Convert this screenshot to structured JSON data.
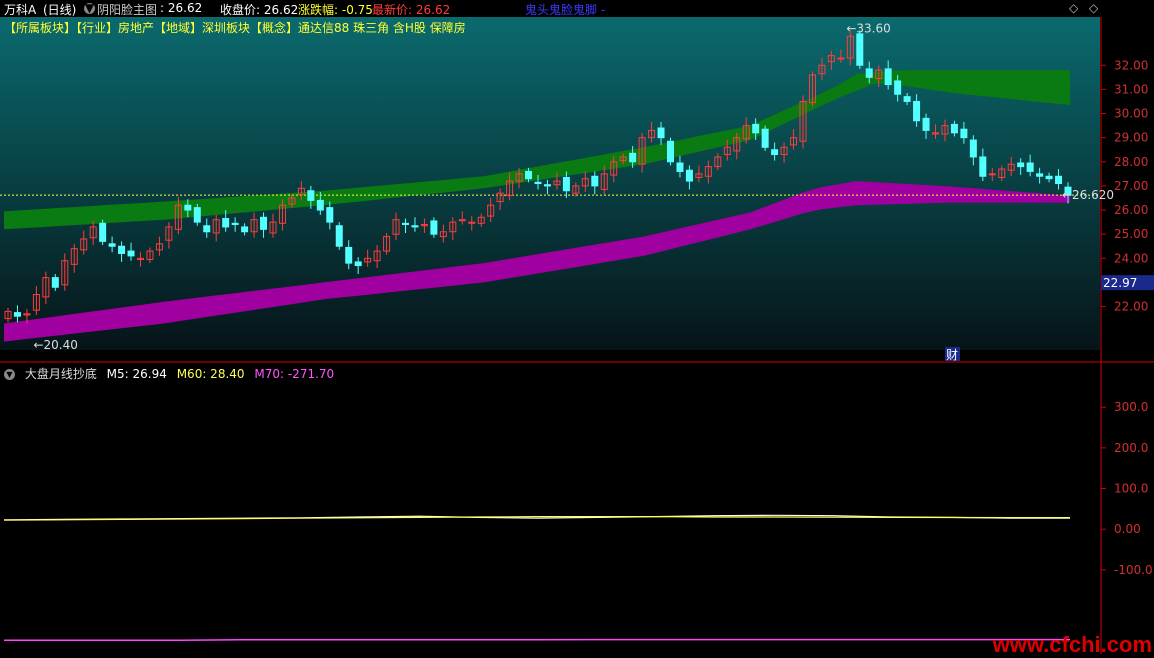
{
  "header": {
    "stock_name": "万科A",
    "period": "(日线)",
    "main_indicator": "阴阳脸主图",
    "main_indicator_value": ": 26.62",
    "close_label": "收盘价: 26.62",
    "change_label": "涨跌幅: -0.75",
    "latest_label": "最新价: 26.62",
    "extra_label": "鬼头鬼脸鬼脚 -"
  },
  "tags": "【所属板块】【行业】房地产【地域】深圳板块【概念】通达信88 珠三角 含H股 保障房",
  "colors": {
    "up": "#ff3c3c",
    "down": "#54ffff",
    "green_band": "#0a7a12",
    "magenta_band": "#a000a0",
    "yellow": "#ffff66",
    "axis_red": "#d00000"
  },
  "chart_data": [
    {
      "type": "candlestick",
      "title": "",
      "ylim": [
        20.2,
        34.0
      ],
      "y_ticks": [
        "22.00",
        "23.00",
        "24.00",
        "25.00",
        "26.00",
        "27.00",
        "28.00",
        "29.00",
        "30.00",
        "31.00",
        "32.00"
      ],
      "max_label": "33.60",
      "min_label": "20.40",
      "last_price_label": "26.620",
      "highlight_label": "22.97",
      "event_label": "财",
      "series": [
        {
          "name": "",
          "values": [
            21.8,
            21.6,
            21.7,
            22.5,
            23.2,
            22.8,
            23.9,
            24.4,
            24.8,
            25.3,
            24.7,
            24.5,
            24.2,
            24.1,
            24.0,
            24.3,
            24.6,
            25.3,
            26.2,
            26.0,
            25.5,
            25.1,
            25.6,
            25.3,
            25.4,
            25.1,
            25.6,
            25.2,
            25.5,
            26.2,
            26.5,
            26.9,
            26.4,
            26.0,
            25.5,
            24.5,
            23.8,
            23.7,
            24.0,
            24.3,
            24.9,
            25.6,
            25.4,
            25.3,
            25.4,
            25.0,
            25.1,
            25.5,
            25.6,
            25.5,
            25.7,
            26.2,
            26.7,
            27.2,
            27.5,
            27.3,
            27.1,
            27.0,
            27.2,
            26.8,
            27.0,
            27.3,
            27.0,
            27.5,
            28.0,
            28.2,
            28.0,
            29.0,
            29.3,
            29.0,
            28.0,
            27.6,
            27.2,
            27.5,
            27.8,
            28.2,
            28.6,
            29.0,
            29.5,
            29.2,
            28.6,
            28.3,
            28.6,
            29.0,
            30.5,
            31.6,
            32.0,
            32.4,
            32.3,
            33.2,
            32.0,
            31.5,
            31.8,
            31.2,
            30.8,
            30.5,
            29.7,
            29.3,
            29.2,
            29.5,
            29.2,
            29.0,
            28.2,
            27.4,
            27.5,
            27.7,
            27.9,
            27.8,
            27.6,
            27.4,
            27.3,
            27.1,
            26.62
          ]
        }
      ]
    },
    {
      "type": "line",
      "title": "大盘月线抄底",
      "ylim": [
        -280,
        330
      ],
      "y_ticks": [
        "300.0",
        "200.0",
        "100.0",
        "0.00",
        "-100.0"
      ],
      "series": [
        {
          "name": "M5",
          "label": "M5: 26.94",
          "values": [
            23,
            24,
            25,
            26,
            27,
            28,
            30,
            32,
            29,
            27,
            29,
            31,
            33,
            34,
            33,
            30,
            29,
            27,
            26.94
          ]
        },
        {
          "name": "M60",
          "label": "M60: 28.40",
          "values": [
            22,
            23,
            24,
            25,
            26,
            27,
            28,
            29,
            30,
            31,
            31,
            31,
            30,
            30,
            29.5,
            29,
            28.8,
            28.5,
            28.4
          ]
        },
        {
          "name": "M70",
          "label": "M70: -271.70",
          "values": [
            -273,
            -273,
            -273,
            -273,
            -272,
            -272,
            -272,
            -272,
            -271.8,
            -271.8,
            -271.7,
            -271.7,
            -271.7,
            -271.7,
            -271.7,
            -271.7,
            -271.7,
            -271.7,
            -271.7
          ]
        }
      ]
    }
  ],
  "watermark": "www.cfchi.com"
}
